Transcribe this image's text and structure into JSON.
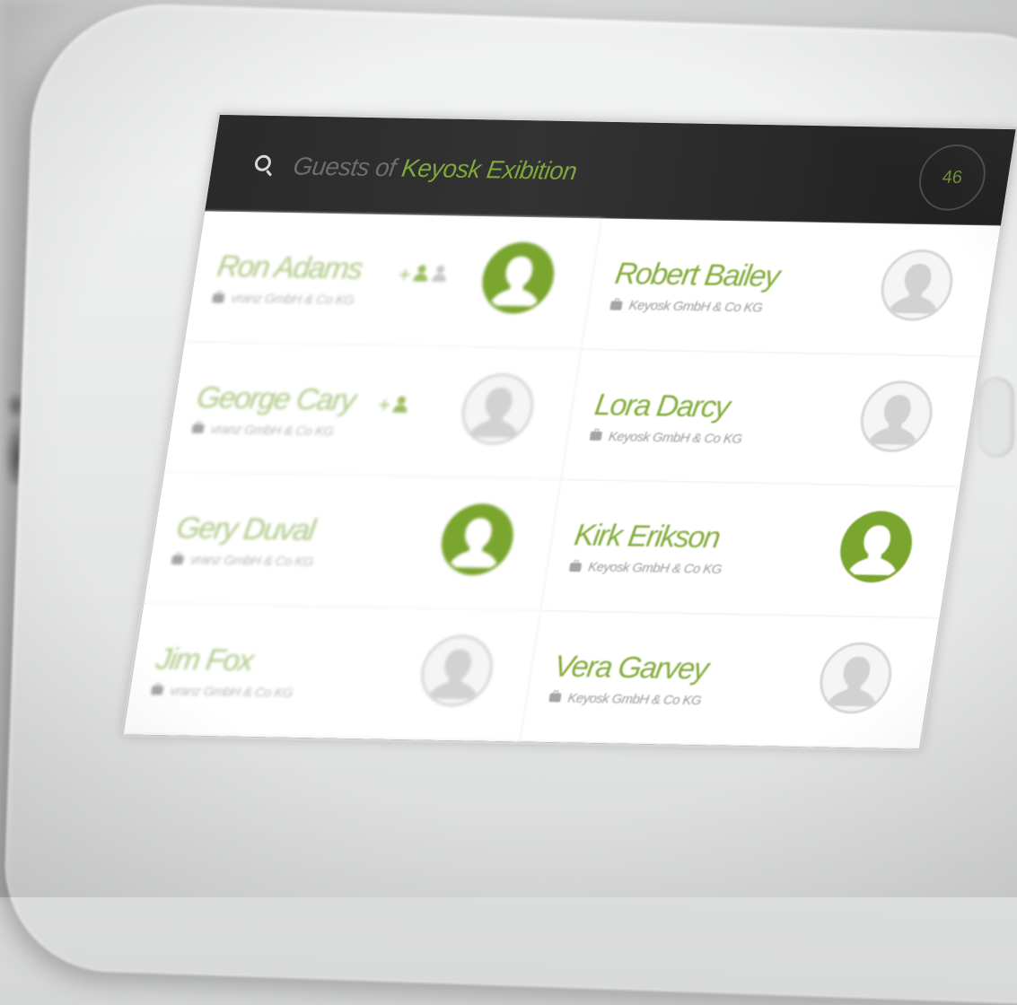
{
  "header": {
    "title_prefix": "Guests of",
    "title_event": "Keyosk Exibition",
    "guest_count": "46"
  },
  "colors": {
    "accent": "#7fa83a",
    "dark_bar": "#2b2b2b",
    "avatar_grey": "#d4d4d4"
  },
  "guests": [
    {
      "name": "Ron Adams",
      "company": "vranz GmbH & Co KG",
      "avatar": "green",
      "companions": [
        "+",
        "green-person",
        "grey-person"
      ]
    },
    {
      "name": "Robert Bailey",
      "company": "Keyosk GmbH & Co KG",
      "avatar": "grey",
      "companions": []
    },
    {
      "name": "George Cary",
      "company": "vranz GmbH & Co KG",
      "avatar": "grey",
      "companions": [
        "+",
        "green-person"
      ]
    },
    {
      "name": "Lora Darcy",
      "company": "Keyosk GmbH & Co KG",
      "avatar": "grey",
      "companions": []
    },
    {
      "name": "Gery Duval",
      "company": "vranz GmbH & Co KG",
      "avatar": "green",
      "companions": []
    },
    {
      "name": "Kirk Erikson",
      "company": "Keyosk GmbH & Co KG",
      "avatar": "green",
      "companions": []
    },
    {
      "name": "Jim Fox",
      "company": "vranz GmbH & Co KG",
      "avatar": "grey",
      "companions": []
    },
    {
      "name": "Vera Garvey",
      "company": "Keyosk GmbH & Co KG",
      "avatar": "grey",
      "companions": []
    }
  ]
}
